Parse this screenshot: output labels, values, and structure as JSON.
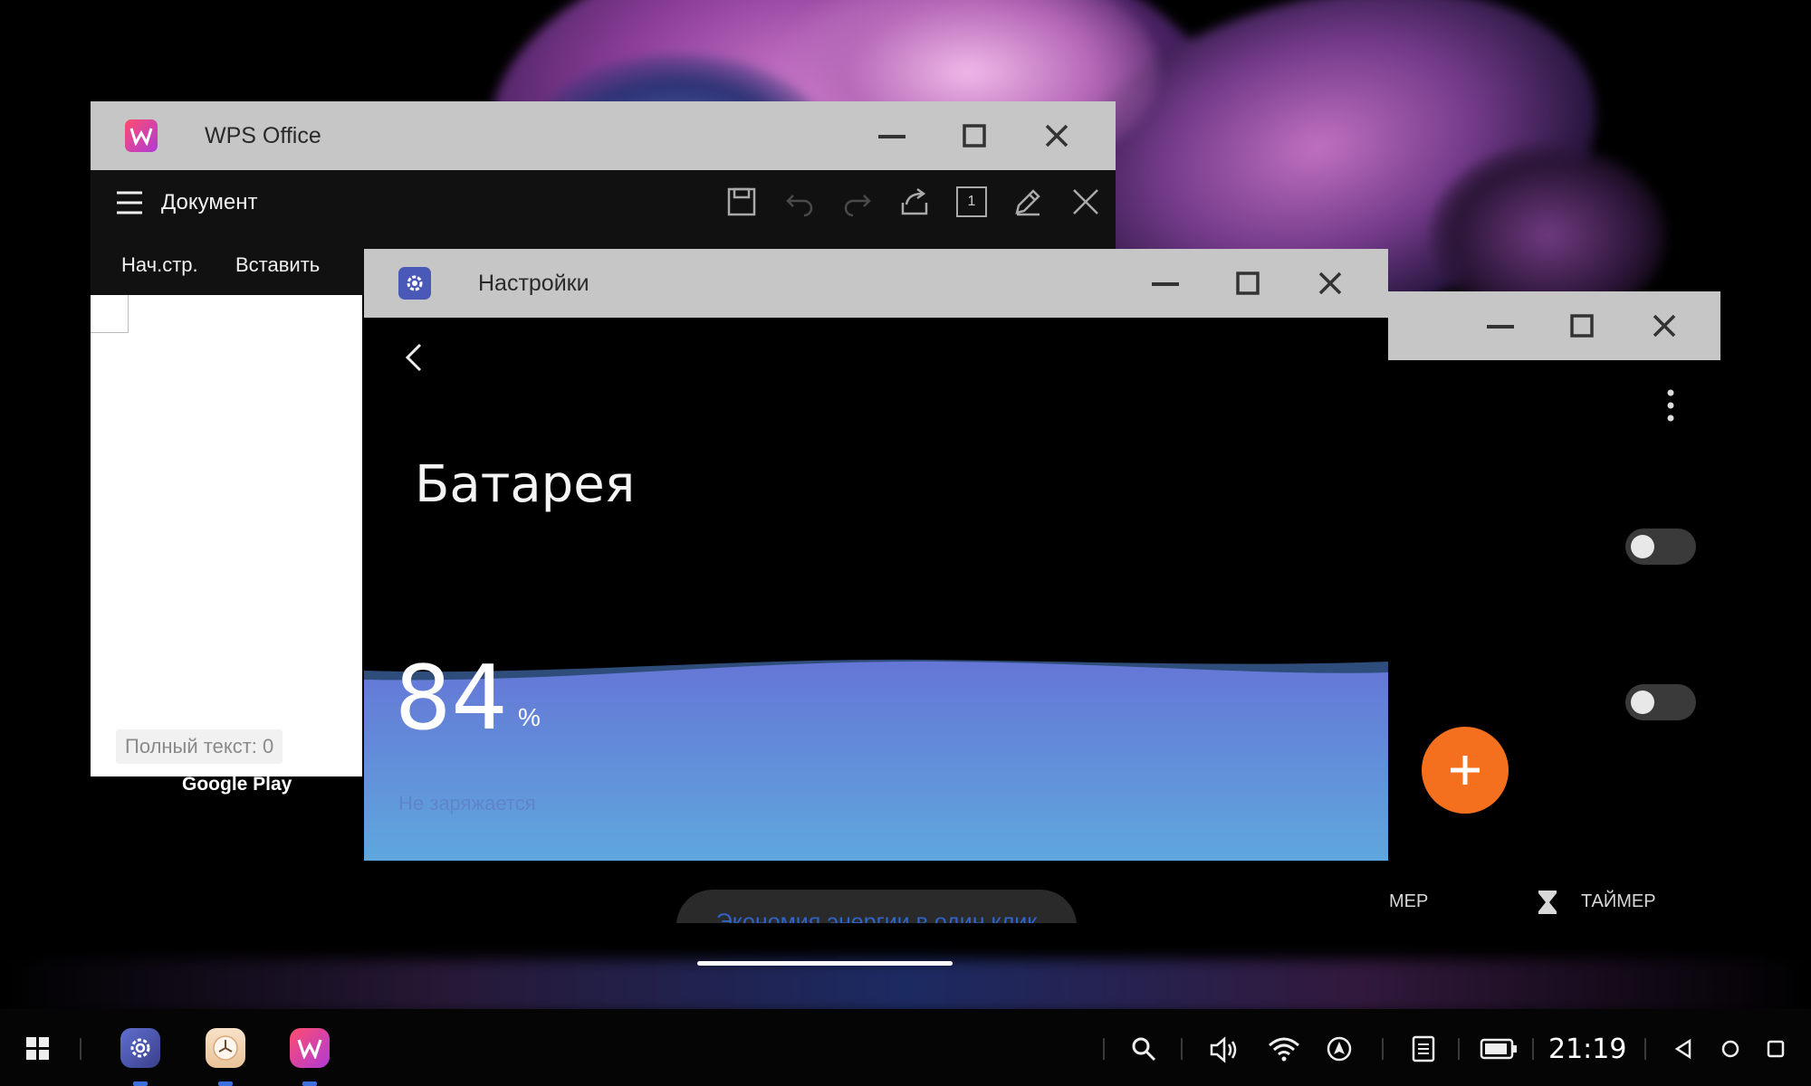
{
  "colors": {
    "titlebar_bg": "#c6c6c6",
    "wps_accent": "#e53c6e",
    "settings_icon": "#4a59b8",
    "battery_wave_top": "#6576d6",
    "battery_wave_bottom": "#5fa7dd",
    "fab_orange": "#f4701f"
  },
  "wps_window": {
    "title": "WPS Office",
    "icon": "wps-logo-icon",
    "document_name": "Документ",
    "tabs": [
      "Нач.стр.",
      "Вставить"
    ],
    "status_text": "Полный текст: 0",
    "toolbar_icons": [
      "save-icon",
      "undo-icon",
      "redo-icon",
      "share-icon",
      "page-count-icon",
      "edit-pen-icon",
      "close-doc-icon"
    ],
    "page_count_label": "1"
  },
  "desktop_label": "Google Play",
  "settings_window": {
    "title": "Настройки",
    "icon": "settings-gear-icon",
    "page_title": "Батарея",
    "battery": {
      "level": 84,
      "level_text": "84",
      "unit": "%",
      "state": "Не заряжается"
    },
    "eco_button_label": "Экономия энергии в один клик"
  },
  "clock_window": {
    "toggles": [
      false,
      false
    ],
    "fab_icon": "plus-icon",
    "tab_partial": "МЕР",
    "timer_tab": "ТАЙМЕР"
  },
  "taskbar": {
    "time": "21:19",
    "pinned_apps": [
      "settings-app-icon",
      "clock-app-icon",
      "wps-app-icon"
    ],
    "tray_icons": [
      "search-icon",
      "volume-icon",
      "wifi-icon",
      "location-icon",
      "notes-icon",
      "battery-icon"
    ],
    "nav_icons": [
      "back-nav-icon",
      "home-nav-icon",
      "recents-nav-icon"
    ]
  }
}
